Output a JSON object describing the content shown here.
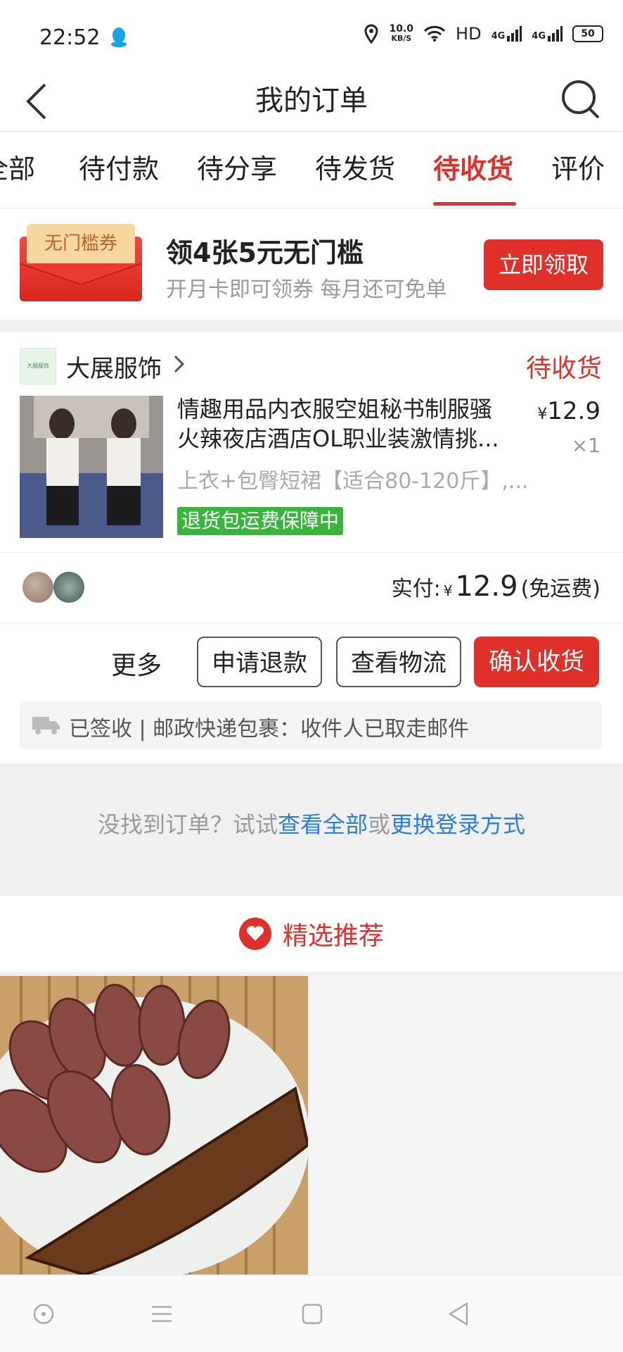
{
  "status_bar": {
    "time": "22:52",
    "net_speed": "10.0",
    "net_unit": "KB/S",
    "hd": "HD",
    "sig1": "4G",
    "sig2": "4G",
    "battery": "50"
  },
  "nav": {
    "title": "我的订单"
  },
  "tabs": [
    "全部",
    "待付款",
    "待分享",
    "待发货",
    "待收货",
    "评价"
  ],
  "active_tab": "待收货",
  "banner": {
    "tag": "无门槛券",
    "title": "领4张5元无门槛",
    "subtitle": "开月卡即可领券 每月还可免单",
    "button": "立即领取"
  },
  "order": {
    "shop_logo_text": "大展服饰",
    "shop_name": "大展服饰",
    "status": "待收货",
    "product_title_line1": "情趣用品内衣服空姐秘书制服骚",
    "product_title_line2": "火辣夜店酒店OL职业装激情挑...",
    "price_symbol": "¥",
    "price": "12.9",
    "quantity": "×1",
    "spec": "上衣+包臀短裙【适合80-120斤】,...",
    "guarantee": "退货包运费保障中",
    "paid_label": "实付:",
    "paid_symbol": "¥",
    "paid_amount": "12.9",
    "shipping_note": "(免运费)",
    "more": "更多",
    "btn_refund": "申请退款",
    "btn_logistics": "查看物流",
    "btn_confirm": "确认收货",
    "logistics": "已签收 | 邮政快递包裹：收件人已取走邮件"
  },
  "hint": {
    "prefix": "没找到订单？试试",
    "link1": "查看全部",
    "mid": "或",
    "link2": "更换登录方式"
  },
  "recommend": {
    "title": "精选推荐"
  },
  "colors": {
    "accent": "#e0302a",
    "link": "#2a7de1",
    "guarantee": "#3bb43e"
  }
}
